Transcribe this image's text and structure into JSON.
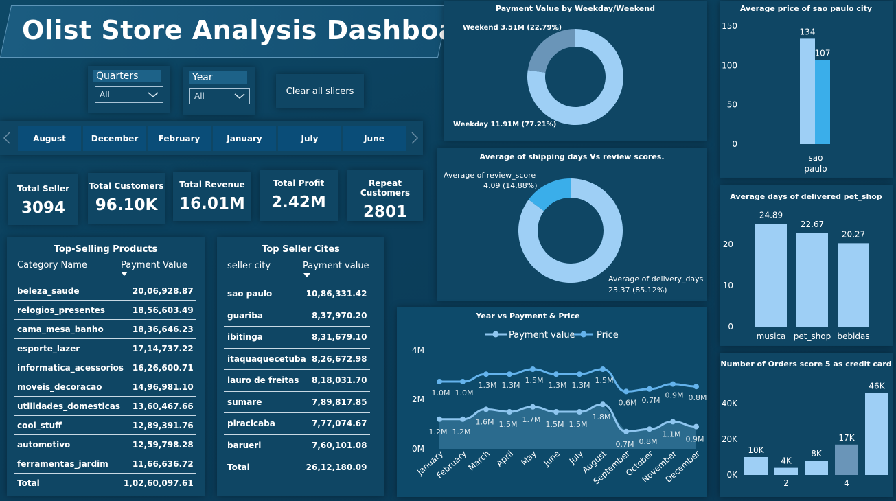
{
  "header": {
    "title": "Olist Store Analysis Dashboard"
  },
  "slicers": {
    "quarters": {
      "label": "Quarters",
      "value": "All"
    },
    "year": {
      "label": "Year",
      "value": "All"
    },
    "clear_label": "Clear all slicers",
    "months": [
      "August",
      "December",
      "February",
      "January",
      "July",
      "June"
    ]
  },
  "kpis": [
    {
      "label": "Total Seller",
      "value": "3094"
    },
    {
      "label": "Total Customers",
      "value": "96.10K"
    },
    {
      "label": "Total Revenue",
      "value": "16.01M"
    },
    {
      "label": "Total Profit",
      "value": "2.42M"
    },
    {
      "label": "Repeat Customers",
      "value": "2801"
    }
  ],
  "top_products": {
    "title": "Top-Selling Products",
    "col1": "Category Name",
    "col2": "Payment Value",
    "rows": [
      [
        "beleza_saude",
        "20,06,928.87"
      ],
      [
        "relogios_presentes",
        "18,56,603.49"
      ],
      [
        "cama_mesa_banho",
        "18,36,646.23"
      ],
      [
        "esporte_lazer",
        "17,14,737.22"
      ],
      [
        "informatica_acessorios",
        "16,26,600.71"
      ],
      [
        "moveis_decoracao",
        "14,96,981.10"
      ],
      [
        "utilidades_domesticas",
        "13,60,467.66"
      ],
      [
        "cool_stuff",
        "12,89,391.76"
      ],
      [
        "automotivo",
        "12,59,798.28"
      ],
      [
        "ferramentas_jardim",
        "11,66,636.72"
      ]
    ],
    "total_label": "Total",
    "total_value": "1,02,60,097.61"
  },
  "top_cities": {
    "title": "Top Seller Cites",
    "col1": "seller city",
    "col2": "Payment value",
    "rows": [
      [
        "sao paulo",
        "10,86,331.42"
      ],
      [
        "guariba",
        "8,37,970.20"
      ],
      [
        "ibitinga",
        "8,31,679.10"
      ],
      [
        "itaquaquecetuba",
        "8,26,672.98"
      ],
      [
        "lauro de freitas",
        "8,18,031.70"
      ],
      [
        "sumare",
        "7,89,817.85"
      ],
      [
        "piracicaba",
        "7,77,074.67"
      ],
      [
        "barueri",
        "7,60,101.08"
      ]
    ],
    "total_label": "Total",
    "total_value": "26,12,180.09"
  },
  "colors": {
    "light_blue": "#9ecff5",
    "bright_blue": "#3aaeea",
    "steel_blue": "#6a95b8",
    "line_dark": "#64b3ec",
    "line_light": "#8fc6ef"
  },
  "chart_data": [
    {
      "id": "weekday",
      "type": "pie",
      "title": "Payment Value by Weekday/Weekend",
      "slices": [
        {
          "name": "Weekday",
          "value": 11.91,
          "label": "Weekday 11.91M (77.21%)"
        },
        {
          "name": "Weekend",
          "value": 3.51,
          "label": "Weekend 3.51M (22.79%)"
        }
      ]
    },
    {
      "id": "shipping",
      "type": "pie",
      "title": "Average of shipping days Vs review scores.",
      "slices": [
        {
          "name": "Average of delivery_days",
          "value": 23.37,
          "label1": "Average of delivery_days",
          "label2": "23.37 (85.12%)"
        },
        {
          "name": "Average of review_score",
          "value": 4.09,
          "label1": "Average of review_score",
          "label2": "4.09 (14.88%)"
        }
      ]
    },
    {
      "id": "yearline",
      "type": "line",
      "title": "Year vs Payment & Price",
      "categories": [
        "January",
        "February",
        "March",
        "April",
        "May",
        "June",
        "July",
        "August",
        "September",
        "October",
        "November",
        "December"
      ],
      "series": [
        {
          "name": "Payment value",
          "values": [
            1.2,
            1.2,
            1.6,
            1.5,
            1.7,
            1.5,
            1.5,
            1.8,
            0.7,
            0.8,
            1.1,
            0.9
          ],
          "labels": [
            "1.2M",
            "1.2M",
            "1.6M",
            "1.5M",
            "1.7M",
            "1.5M",
            "1.5M",
            "1.8M",
            "0.7M",
            "0.8M",
            "1.1M",
            "0.9M"
          ]
        },
        {
          "name": "Price",
          "values": [
            1.0,
            1.0,
            1.3,
            1.3,
            1.5,
            1.3,
            1.3,
            1.5,
            0.6,
            0.7,
            0.9,
            0.8
          ],
          "labels": [
            "1.0M",
            "1.0M",
            "1.3M",
            "1.3M",
            "1.5M",
            "1.3M",
            "1.3M",
            "1.5M",
            "0.6M",
            "0.7M",
            "0.9M",
            "0.8M"
          ]
        }
      ],
      "yticks": [
        "0M",
        "2M",
        "4M"
      ]
    },
    {
      "id": "saopaulo",
      "type": "bar",
      "title": "Average price of sao paulo city",
      "category_line1": "sao",
      "category_line2": "paulo",
      "values": [
        134,
        107
      ],
      "labels": [
        "134",
        "107"
      ],
      "yticks": [
        "0",
        "50",
        "100",
        "150"
      ],
      "ylim": [
        0,
        150
      ]
    },
    {
      "id": "petshop",
      "type": "bar",
      "title": "Average days of delivered pet_shop",
      "categories": [
        "musica",
        "pet_shop",
        "bebidas"
      ],
      "values": [
        24.89,
        22.67,
        20.27
      ],
      "labels": [
        "24.89",
        "22.67",
        "20.27"
      ],
      "yticks": [
        "0",
        "10",
        "20"
      ],
      "ylim": [
        0,
        27
      ]
    },
    {
      "id": "orders",
      "type": "bar",
      "title": "Number of Orders score 5 as credit card",
      "values": [
        10,
        4,
        8,
        17,
        46
      ],
      "labels": [
        "10K",
        "4K",
        "8K",
        "17K",
        "46K"
      ],
      "xticks": [
        "",
        "2",
        "",
        "4",
        ""
      ],
      "yticks": [
        "0K",
        "20K",
        "40K"
      ],
      "ylim": [
        0,
        50
      ]
    }
  ]
}
